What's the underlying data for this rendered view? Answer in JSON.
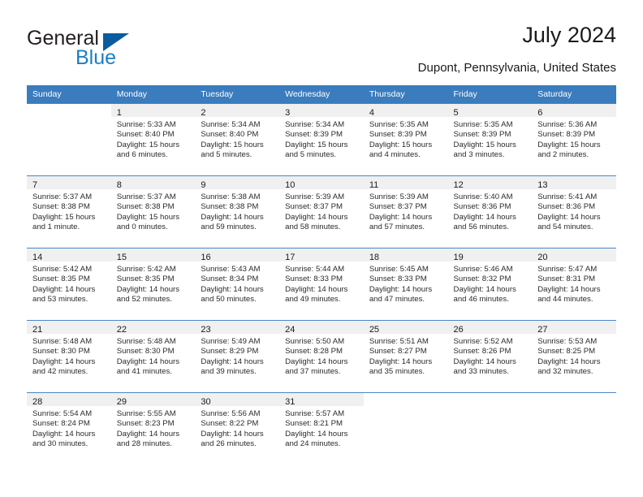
{
  "brand": {
    "word_general": "General",
    "word_blue": "Blue",
    "triangle_color": "#0a5c9e",
    "blue_text_color": "#1b7fc3"
  },
  "header": {
    "title": "July 2024",
    "subtitle": "Dupont, Pennsylvania, United States"
  },
  "theme": {
    "header_bg": "#3a7cbd",
    "row_divider": "#4a86c5",
    "daynum_band_bg": "#f0f0f0"
  },
  "calendar": {
    "weekday_headers": [
      "Sunday",
      "Monday",
      "Tuesday",
      "Wednesday",
      "Thursday",
      "Friday",
      "Saturday"
    ],
    "weeks": [
      [
        {
          "day": "",
          "sunrise": "",
          "sunset": "",
          "daylight": "",
          "blank": true
        },
        {
          "day": "1",
          "sunrise": "Sunrise: 5:33 AM",
          "sunset": "Sunset: 8:40 PM",
          "daylight": "Daylight: 15 hours and 6 minutes."
        },
        {
          "day": "2",
          "sunrise": "Sunrise: 5:34 AM",
          "sunset": "Sunset: 8:40 PM",
          "daylight": "Daylight: 15 hours and 5 minutes."
        },
        {
          "day": "3",
          "sunrise": "Sunrise: 5:34 AM",
          "sunset": "Sunset: 8:39 PM",
          "daylight": "Daylight: 15 hours and 5 minutes."
        },
        {
          "day": "4",
          "sunrise": "Sunrise: 5:35 AM",
          "sunset": "Sunset: 8:39 PM",
          "daylight": "Daylight: 15 hours and 4 minutes."
        },
        {
          "day": "5",
          "sunrise": "Sunrise: 5:35 AM",
          "sunset": "Sunset: 8:39 PM",
          "daylight": "Daylight: 15 hours and 3 minutes."
        },
        {
          "day": "6",
          "sunrise": "Sunrise: 5:36 AM",
          "sunset": "Sunset: 8:39 PM",
          "daylight": "Daylight: 15 hours and 2 minutes."
        }
      ],
      [
        {
          "day": "7",
          "sunrise": "Sunrise: 5:37 AM",
          "sunset": "Sunset: 8:38 PM",
          "daylight": "Daylight: 15 hours and 1 minute."
        },
        {
          "day": "8",
          "sunrise": "Sunrise: 5:37 AM",
          "sunset": "Sunset: 8:38 PM",
          "daylight": "Daylight: 15 hours and 0 minutes."
        },
        {
          "day": "9",
          "sunrise": "Sunrise: 5:38 AM",
          "sunset": "Sunset: 8:38 PM",
          "daylight": "Daylight: 14 hours and 59 minutes."
        },
        {
          "day": "10",
          "sunrise": "Sunrise: 5:39 AM",
          "sunset": "Sunset: 8:37 PM",
          "daylight": "Daylight: 14 hours and 58 minutes."
        },
        {
          "day": "11",
          "sunrise": "Sunrise: 5:39 AM",
          "sunset": "Sunset: 8:37 PM",
          "daylight": "Daylight: 14 hours and 57 minutes."
        },
        {
          "day": "12",
          "sunrise": "Sunrise: 5:40 AM",
          "sunset": "Sunset: 8:36 PM",
          "daylight": "Daylight: 14 hours and 56 minutes."
        },
        {
          "day": "13",
          "sunrise": "Sunrise: 5:41 AM",
          "sunset": "Sunset: 8:36 PM",
          "daylight": "Daylight: 14 hours and 54 minutes."
        }
      ],
      [
        {
          "day": "14",
          "sunrise": "Sunrise: 5:42 AM",
          "sunset": "Sunset: 8:35 PM",
          "daylight": "Daylight: 14 hours and 53 minutes."
        },
        {
          "day": "15",
          "sunrise": "Sunrise: 5:42 AM",
          "sunset": "Sunset: 8:35 PM",
          "daylight": "Daylight: 14 hours and 52 minutes."
        },
        {
          "day": "16",
          "sunrise": "Sunrise: 5:43 AM",
          "sunset": "Sunset: 8:34 PM",
          "daylight": "Daylight: 14 hours and 50 minutes."
        },
        {
          "day": "17",
          "sunrise": "Sunrise: 5:44 AM",
          "sunset": "Sunset: 8:33 PM",
          "daylight": "Daylight: 14 hours and 49 minutes."
        },
        {
          "day": "18",
          "sunrise": "Sunrise: 5:45 AM",
          "sunset": "Sunset: 8:33 PM",
          "daylight": "Daylight: 14 hours and 47 minutes."
        },
        {
          "day": "19",
          "sunrise": "Sunrise: 5:46 AM",
          "sunset": "Sunset: 8:32 PM",
          "daylight": "Daylight: 14 hours and 46 minutes."
        },
        {
          "day": "20",
          "sunrise": "Sunrise: 5:47 AM",
          "sunset": "Sunset: 8:31 PM",
          "daylight": "Daylight: 14 hours and 44 minutes."
        }
      ],
      [
        {
          "day": "21",
          "sunrise": "Sunrise: 5:48 AM",
          "sunset": "Sunset: 8:30 PM",
          "daylight": "Daylight: 14 hours and 42 minutes."
        },
        {
          "day": "22",
          "sunrise": "Sunrise: 5:48 AM",
          "sunset": "Sunset: 8:30 PM",
          "daylight": "Daylight: 14 hours and 41 minutes."
        },
        {
          "day": "23",
          "sunrise": "Sunrise: 5:49 AM",
          "sunset": "Sunset: 8:29 PM",
          "daylight": "Daylight: 14 hours and 39 minutes."
        },
        {
          "day": "24",
          "sunrise": "Sunrise: 5:50 AM",
          "sunset": "Sunset: 8:28 PM",
          "daylight": "Daylight: 14 hours and 37 minutes."
        },
        {
          "day": "25",
          "sunrise": "Sunrise: 5:51 AM",
          "sunset": "Sunset: 8:27 PM",
          "daylight": "Daylight: 14 hours and 35 minutes."
        },
        {
          "day": "26",
          "sunrise": "Sunrise: 5:52 AM",
          "sunset": "Sunset: 8:26 PM",
          "daylight": "Daylight: 14 hours and 33 minutes."
        },
        {
          "day": "27",
          "sunrise": "Sunrise: 5:53 AM",
          "sunset": "Sunset: 8:25 PM",
          "daylight": "Daylight: 14 hours and 32 minutes."
        }
      ],
      [
        {
          "day": "28",
          "sunrise": "Sunrise: 5:54 AM",
          "sunset": "Sunset: 8:24 PM",
          "daylight": "Daylight: 14 hours and 30 minutes."
        },
        {
          "day": "29",
          "sunrise": "Sunrise: 5:55 AM",
          "sunset": "Sunset: 8:23 PM",
          "daylight": "Daylight: 14 hours and 28 minutes."
        },
        {
          "day": "30",
          "sunrise": "Sunrise: 5:56 AM",
          "sunset": "Sunset: 8:22 PM",
          "daylight": "Daylight: 14 hours and 26 minutes."
        },
        {
          "day": "31",
          "sunrise": "Sunrise: 5:57 AM",
          "sunset": "Sunset: 8:21 PM",
          "daylight": "Daylight: 14 hours and 24 minutes."
        },
        {
          "day": "",
          "sunrise": "",
          "sunset": "",
          "daylight": "",
          "blank": true
        },
        {
          "day": "",
          "sunrise": "",
          "sunset": "",
          "daylight": "",
          "blank": true
        },
        {
          "day": "",
          "sunrise": "",
          "sunset": "",
          "daylight": "",
          "blank": true
        }
      ]
    ]
  }
}
